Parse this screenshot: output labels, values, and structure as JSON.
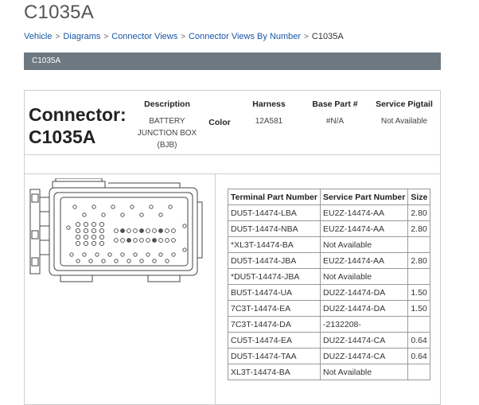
{
  "page": {
    "title": "C1035A"
  },
  "breadcrumb": {
    "items": [
      "Vehicle",
      "Diagrams",
      "Connector Views",
      "Connector Views By Number"
    ],
    "current": "C1035A"
  },
  "section": {
    "header": "C1035A"
  },
  "connector": {
    "label": "Connector:",
    "id": "C1035A",
    "description_header": "Description",
    "description_lines": [
      "BATTERY",
      "JUNCTION BOX",
      "(BJB)"
    ],
    "color_header": "Color",
    "harness_header": "Harness",
    "harness_value": "12A581",
    "base_part_header": "Base Part #",
    "base_part_value": "#N/A",
    "service_pigtail_header": "Service Pigtail",
    "service_pigtail_value": "Not Available"
  },
  "terminals": {
    "headers": [
      "Terminal Part Number",
      "Service Part Number",
      "Size"
    ],
    "rows": [
      [
        "DU5T-14474-LBA",
        "EU2Z-14474-AA",
        "2.80"
      ],
      [
        "DU5T-14474-NBA",
        "EU2Z-14474-AA",
        "2.80"
      ],
      [
        "*XL3T-14474-BA",
        "Not Available",
        ""
      ],
      [
        "DU5T-14474-JBA",
        "EU2Z-14474-AA",
        "2.80"
      ],
      [
        "*DU5T-14474-JBA",
        "Not Available",
        ""
      ],
      [
        "BU5T-14474-UA",
        "DU2Z-14474-DA",
        "1.50"
      ],
      [
        "7C3T-14474-EA",
        "DU2Z-14474-DA",
        "1.50"
      ],
      [
        "7C3T-14474-DA",
        "-2132208-",
        ""
      ],
      [
        "CU5T-14474-EA",
        "DU2Z-14474-CA",
        "0.64"
      ],
      [
        "DU5T-14474-TAA",
        "DU2Z-14474-CA",
        "0.64"
      ],
      [
        "XL3T-14474-BA",
        "Not Available",
        ""
      ]
    ]
  }
}
